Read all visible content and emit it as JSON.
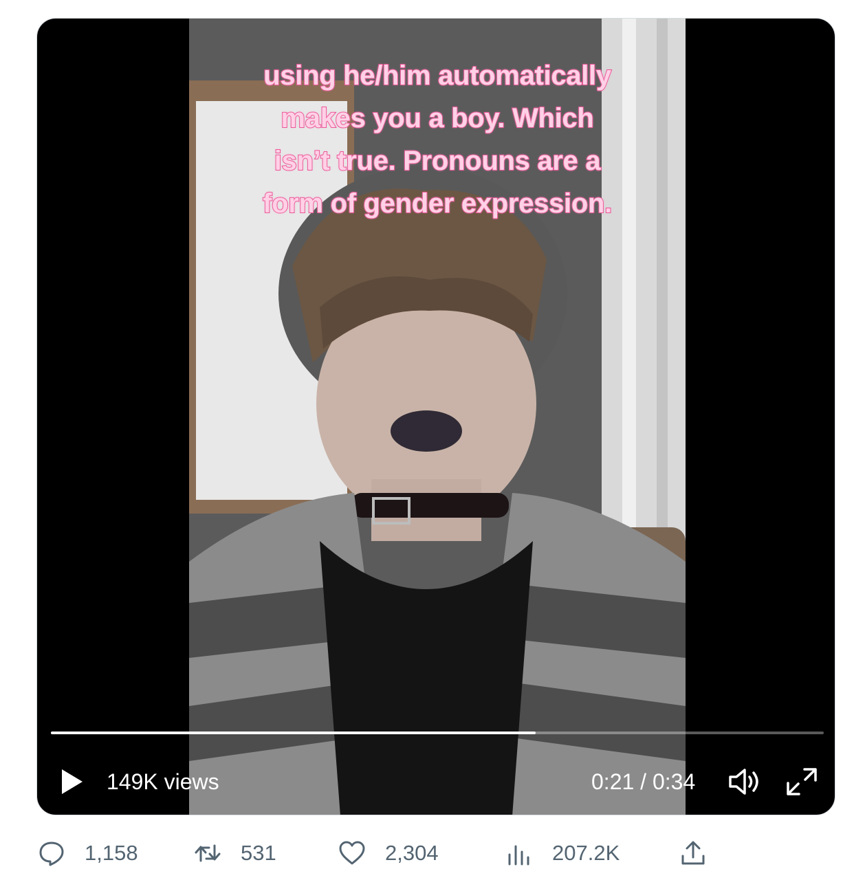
{
  "video": {
    "caption_lines": [
      "using he/him automatically",
      "makes you a boy. Which",
      "isn’t true. Pronouns are a",
      "form of gender expression."
    ],
    "views": "149K views",
    "time": "0:21 / 0:34",
    "progress": 0.627,
    "icons": {
      "play": "play-icon",
      "volume": "volume-icon",
      "fullscreen": "fullscreen-icon"
    }
  },
  "actions": {
    "replies": "1,158",
    "retweets": "531",
    "likes": "2,304",
    "views": "207.2K",
    "icons": {
      "reply": "reply-icon",
      "retweet": "retweet-icon",
      "like": "heart-icon",
      "views": "analytics-icon",
      "share": "share-icon"
    }
  },
  "colors": {
    "caption_fill": "#ffd1e6",
    "caption_outline": "#e84f93",
    "action_gray": "#536471"
  }
}
